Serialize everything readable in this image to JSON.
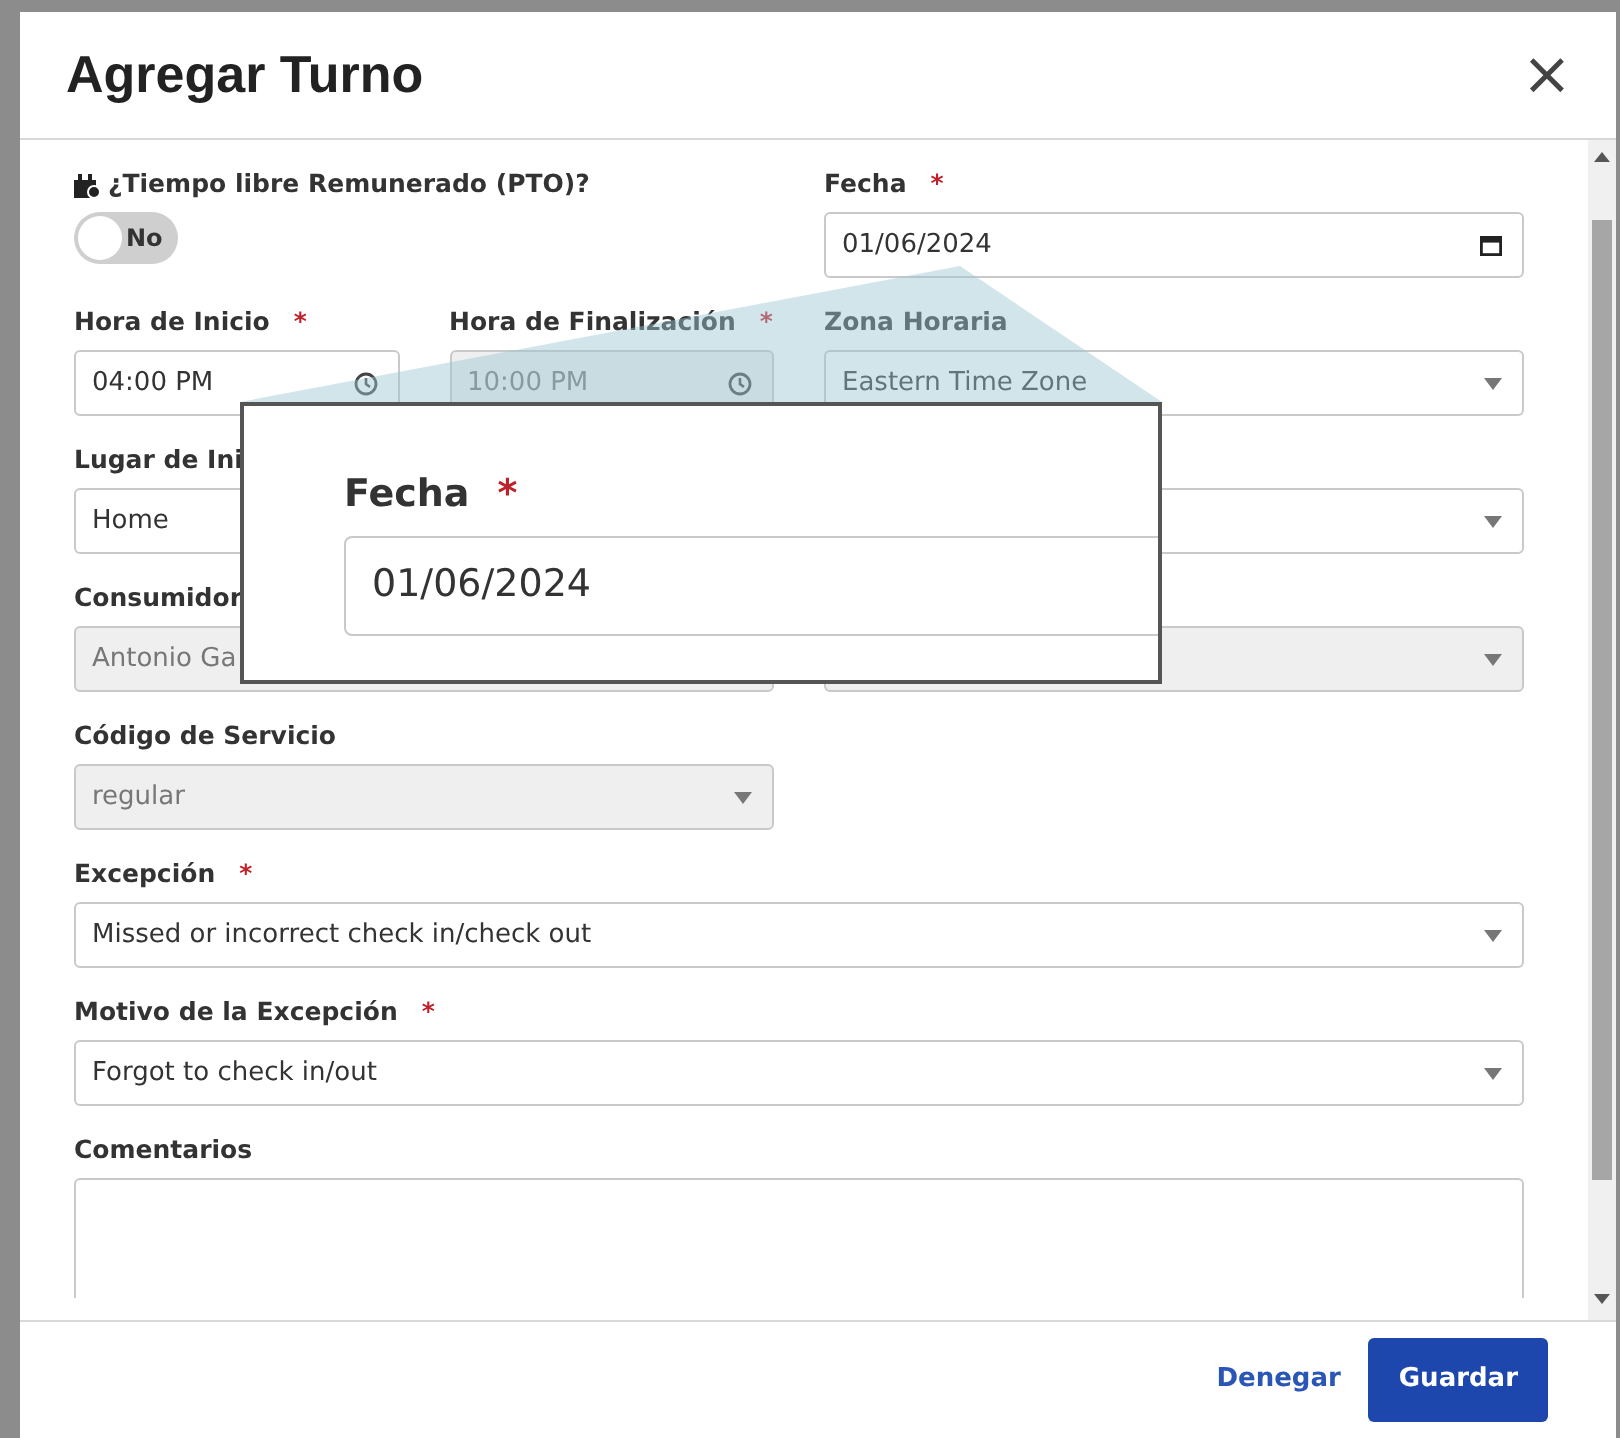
{
  "dialog": {
    "title": "Agregar Turno",
    "close": "×"
  },
  "rows": [
    {
      "left": [
        {
          "kind": "toggle",
          "label": "¿Tiempo libre Remunerado (PTO)?",
          "on": false,
          "state_text": "No"
        }
      ],
      "right": [
        {
          "kind": "date",
          "label": "Fecha",
          "required_mark": "*",
          "value": "01/06/2024",
          "disabled": false
        }
      ]
    },
    {
      "left": [
        {
          "kind": "time",
          "label": "Hora de Inicio",
          "required_mark": "*",
          "value": "04:00 PM",
          "disabled": false
        },
        {
          "kind": "time",
          "label": "Hora de Finalización",
          "required_mark": "*",
          "value": "10:00 PM",
          "disabled": true
        }
      ],
      "right": [
        {
          "kind": "select",
          "label": "Zona Horaria",
          "value": "Eastern Time Zone",
          "disabled": false
        }
      ]
    },
    {
      "left": [
        {
          "kind": "input",
          "label": "Lugar de Ini",
          "value": "Home",
          "disabled": false
        }
      ],
      "right": [
        {
          "kind": "select",
          "disabled": false
        }
      ]
    },
    {
      "left": [
        {
          "kind": "input",
          "label": "Consumidor",
          "value": "Antonio Ga",
          "disabled": true
        }
      ],
      "right": [
        {
          "kind": "select",
          "disabled": true
        }
      ]
    },
    {
      "left": [
        {
          "kind": "select",
          "label": "Código de Servicio",
          "value": "regular",
          "disabled": true
        }
      ]
    },
    {
      "full": [
        {
          "kind": "select",
          "label": "Excepción",
          "required_mark": "*",
          "value": "Missed or incorrect check in/check out",
          "disabled": false
        }
      ]
    },
    {
      "full": [
        {
          "kind": "select",
          "label": "Motivo de la Excepción",
          "required_mark": "*",
          "value": "Forgot to check in/out",
          "disabled": false
        }
      ]
    },
    {
      "full": [
        {
          "kind": "textarea",
          "label": "Comentarios",
          "disabled": false
        }
      ]
    }
  ],
  "magnifier": {
    "label": "Fecha",
    "required_mark": "*",
    "value": "01/06/2024"
  },
  "footer": {
    "cancel": "Denegar",
    "save": "Guardar"
  }
}
